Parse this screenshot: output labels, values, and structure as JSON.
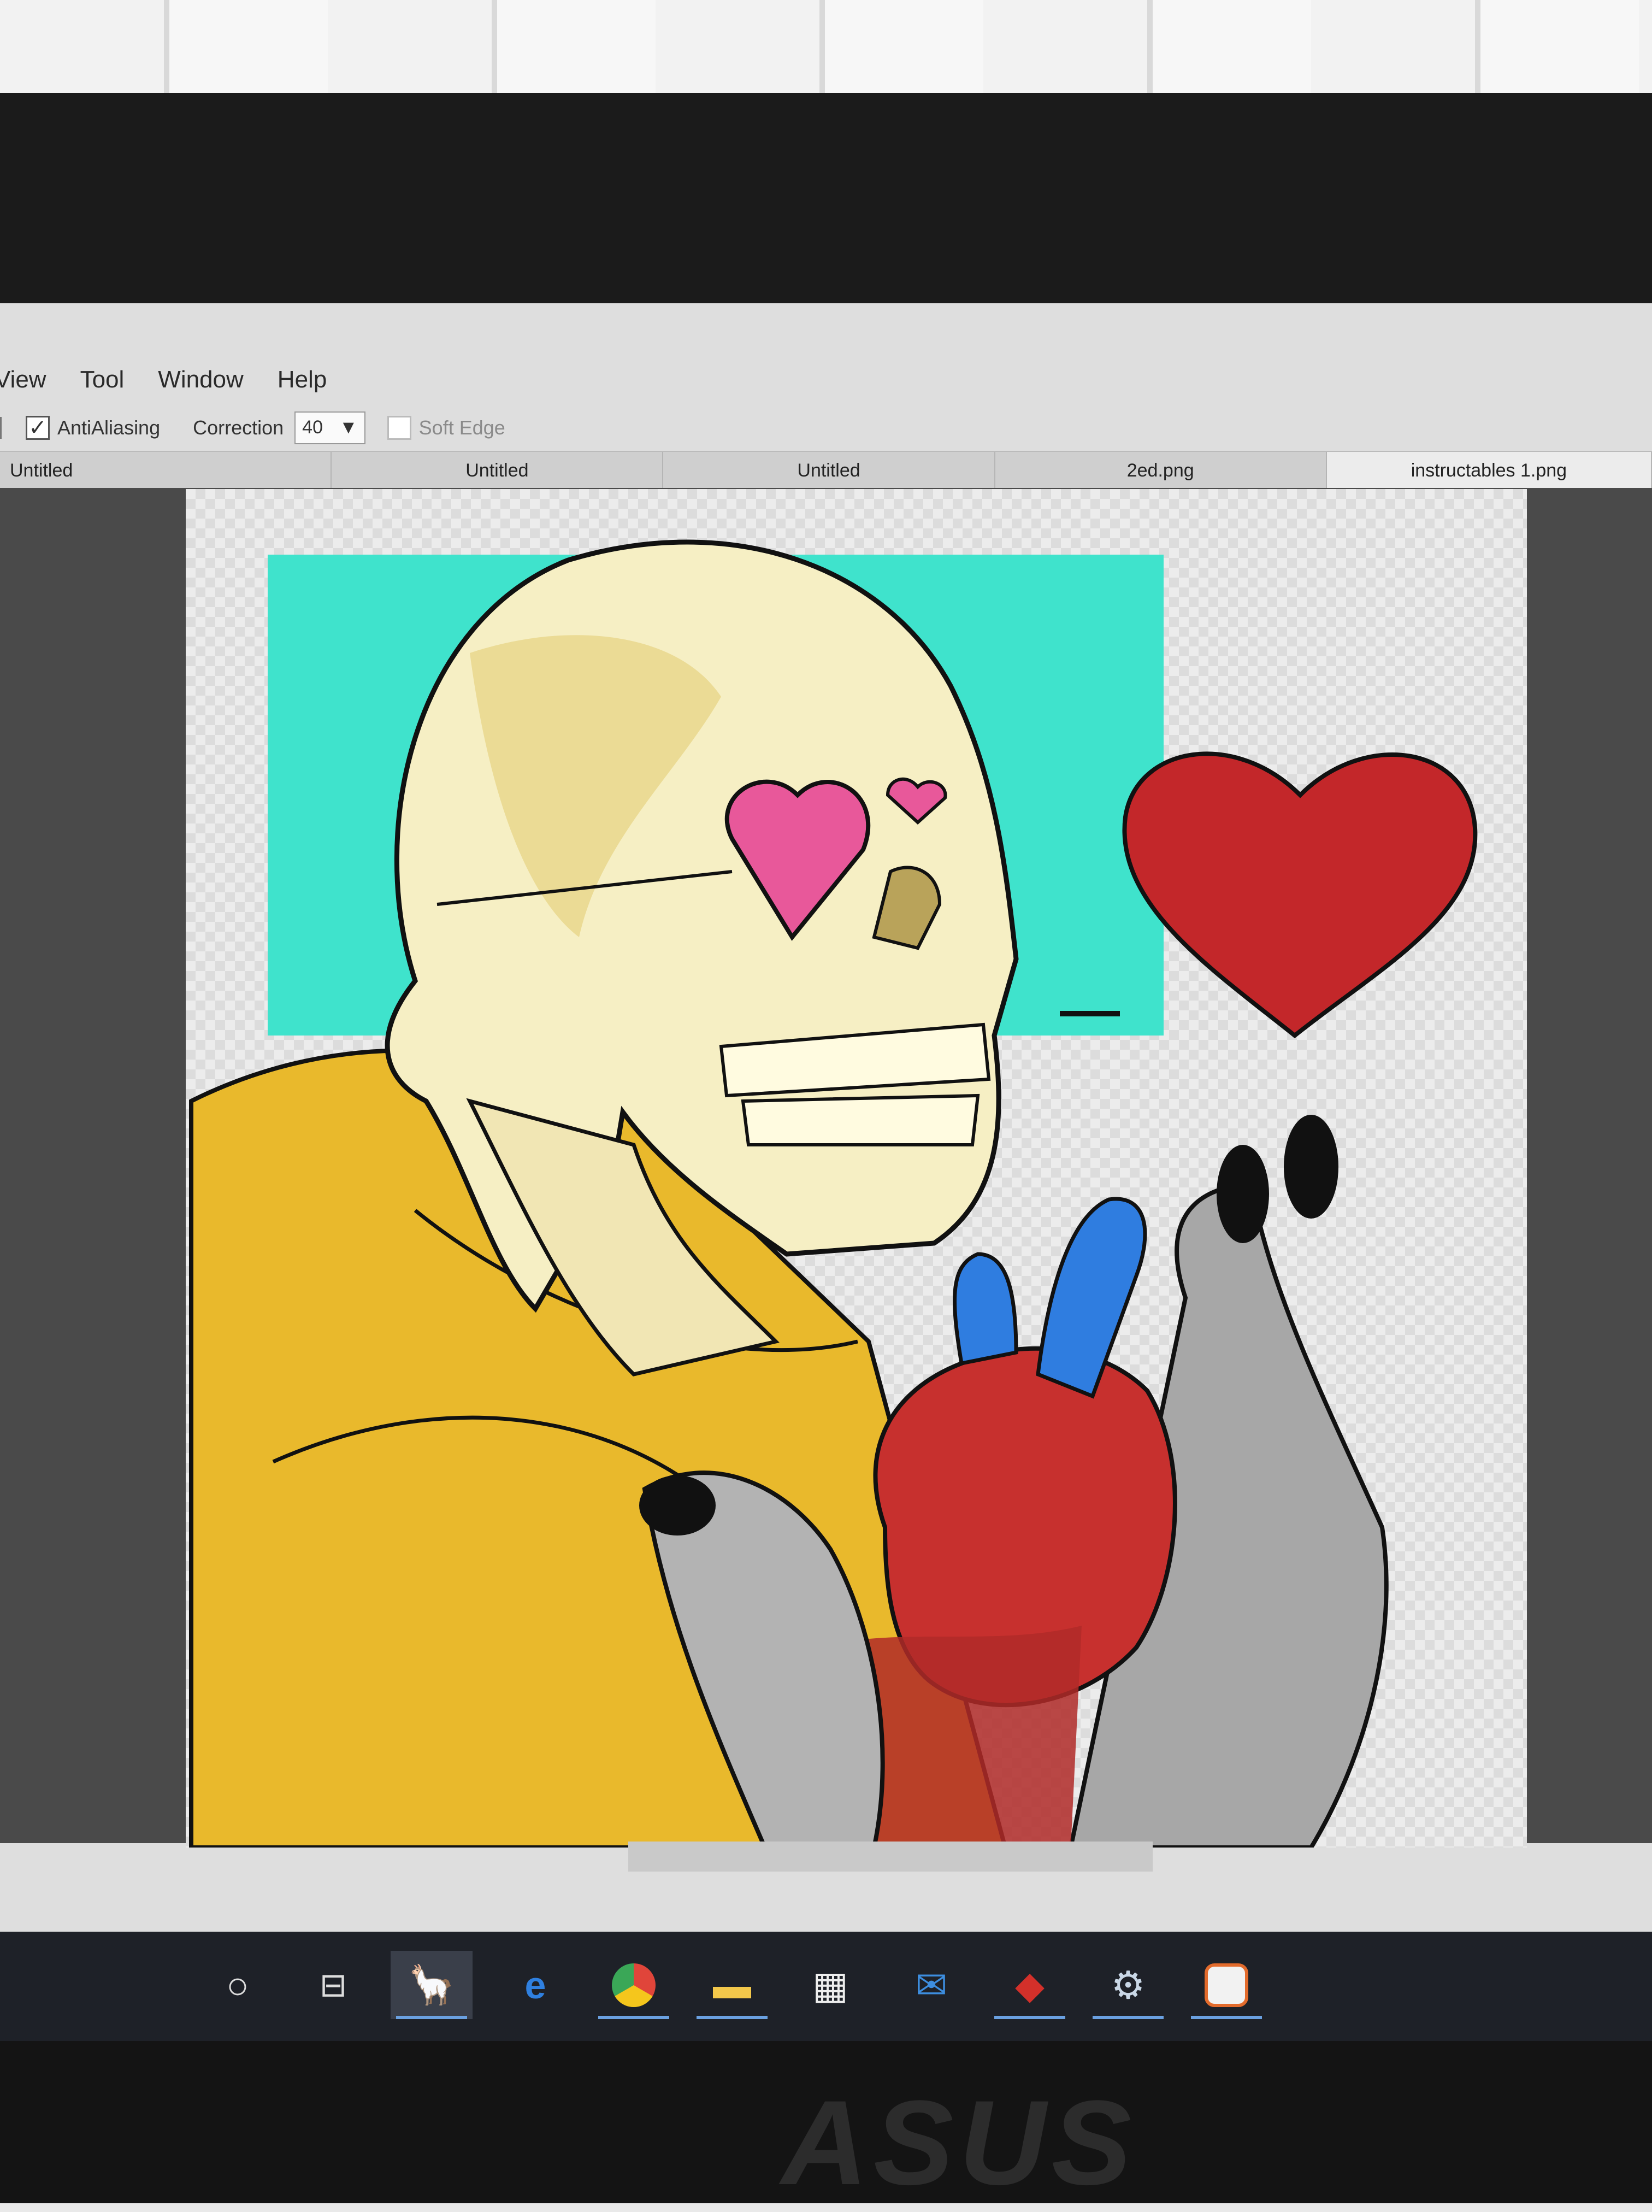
{
  "menu": {
    "items": [
      "View",
      "Tool",
      "Window",
      "Help"
    ]
  },
  "toolbar": {
    "antialiasing_label": "AntiAliasing",
    "antialiasing_checked": true,
    "correction_label": "Correction",
    "correction_value": "40",
    "soft_edge_label": "Soft Edge",
    "soft_edge_checked": false
  },
  "tabs": [
    {
      "label": "Untitled",
      "active": false
    },
    {
      "label": "Untitled",
      "active": false
    },
    {
      "label": "Untitled",
      "active": false
    },
    {
      "label": "2ed.png",
      "active": false
    },
    {
      "label": "instructables 1.png",
      "active": true
    }
  ],
  "taskbar": {
    "icons": [
      "cortana-icon",
      "task-view-icon",
      "paint-app-icon",
      "edge-icon",
      "chrome-icon",
      "file-explorer-icon",
      "store-icon",
      "mail-icon",
      "app-red-icon",
      "steam-icon",
      "firefox-icon"
    ]
  },
  "colors": {
    "teal_bg": "#3fe3cc",
    "hoodie": "#e9b92c",
    "skull": "#f6efc4",
    "heart_red": "#c3272a",
    "glasses_pink": "#e8589a",
    "vein_blue": "#2f7de0",
    "hand_gray": "#a7a7a7"
  },
  "bezel_brand": "ASUS"
}
